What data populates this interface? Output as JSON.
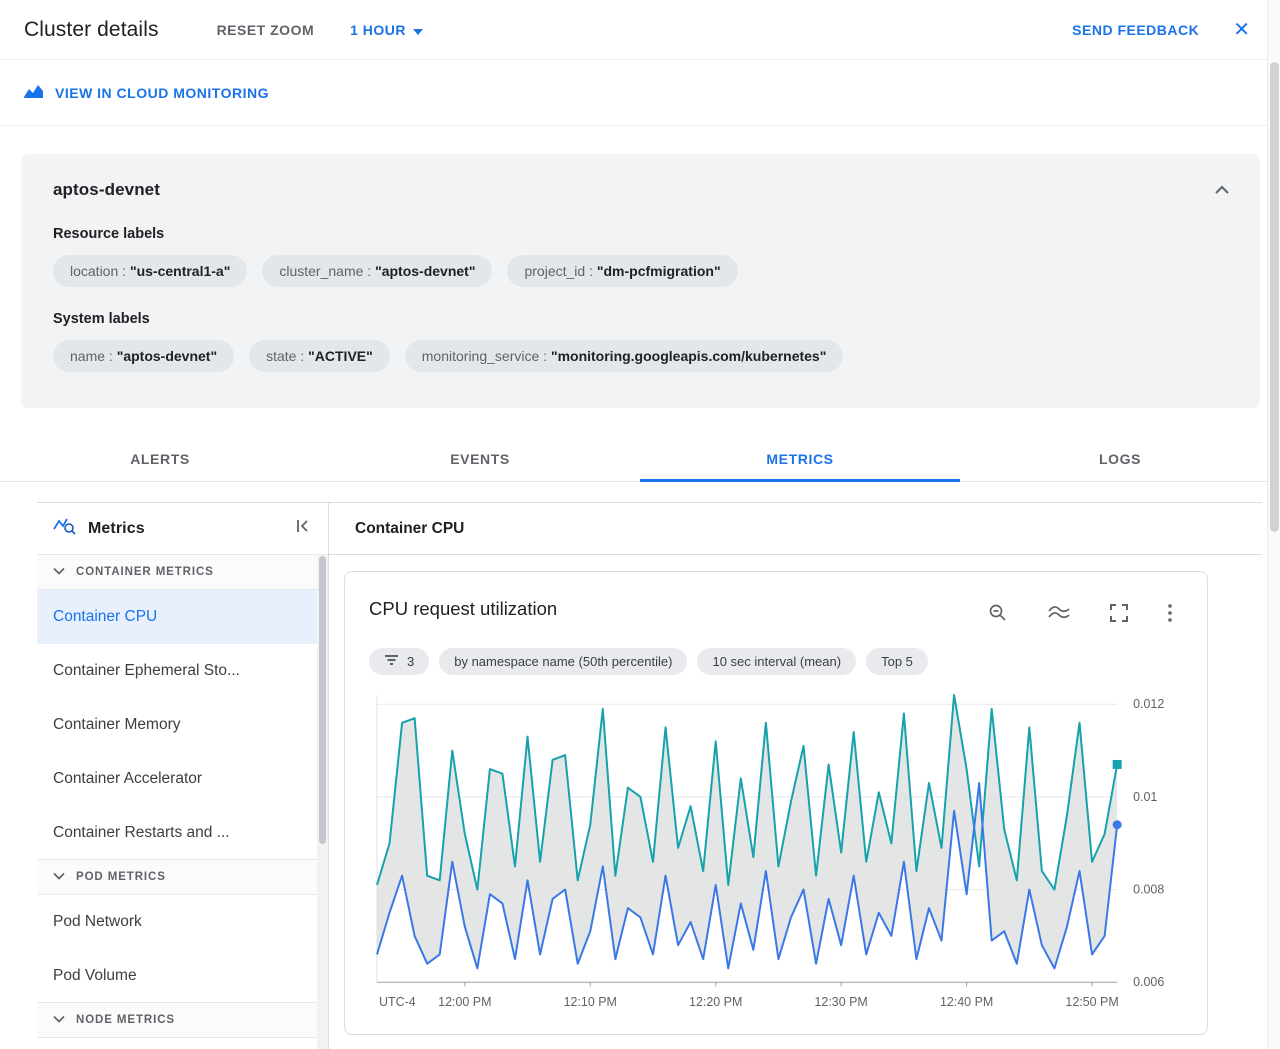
{
  "header": {
    "title": "Cluster details",
    "reset_zoom_label": "RESET ZOOM",
    "time_range_label": "1 HOUR",
    "send_feedback_label": "SEND FEEDBACK"
  },
  "icons": {
    "close_glyph": "✕"
  },
  "theme": {
    "accent_blue": "#1a73e8",
    "selected_item_bg": "#e8f0fe",
    "card_bg": "#f1f3f4"
  },
  "monitoring_bar": {
    "link_label": "VIEW IN CLOUD MONITORING"
  },
  "cluster": {
    "name": "aptos-devnet",
    "label_separator": " : ",
    "resource_labels_title": "Resource labels",
    "resource_labels": [
      {
        "key": "location",
        "value": "\"us-central1-a\""
      },
      {
        "key": "cluster_name",
        "value": "\"aptos-devnet\""
      },
      {
        "key": "project_id",
        "value": "\"dm-pcfmigration\""
      }
    ],
    "system_labels_title": "System labels",
    "system_labels": [
      {
        "key": "name",
        "value": "\"aptos-devnet\""
      },
      {
        "key": "state",
        "value": "\"ACTIVE\""
      },
      {
        "key": "monitoring_service",
        "value": "\"monitoring.googleapis.com/kubernetes\""
      }
    ]
  },
  "tabs": [
    {
      "label": "ALERTS",
      "active": false
    },
    {
      "label": "EVENTS",
      "active": false
    },
    {
      "label": "METRICS",
      "active": true
    },
    {
      "label": "LOGS",
      "active": false
    }
  ],
  "sidebar": {
    "title": "Metrics",
    "selected_item": "Container CPU",
    "sections": [
      {
        "label": "CONTAINER METRICS",
        "items": [
          "Container CPU",
          "Container Ephemeral Sto...",
          "Container Memory",
          "Container Accelerator",
          "Container Restarts and ..."
        ]
      },
      {
        "label": "POD METRICS",
        "items": [
          "Pod Network",
          "Pod Volume"
        ]
      },
      {
        "label": "NODE METRICS",
        "items": []
      }
    ]
  },
  "main": {
    "title": "Container CPU"
  },
  "chart": {
    "title": "CPU request utilization",
    "filters": {
      "count": "3",
      "breakdown": "by namespace name (50th percentile)",
      "interval": "10 sec interval (mean)",
      "top": "Top 5"
    }
  },
  "chart_data": {
    "type": "line",
    "title": "CPU request utilization",
    "x_corner_label": "UTC-4",
    "x_ticks": [
      {
        "min": 7,
        "label": "12:00 PM"
      },
      {
        "min": 17,
        "label": "12:10 PM"
      },
      {
        "min": 27,
        "label": "12:20 PM"
      },
      {
        "min": 37,
        "label": "12:30 PM"
      },
      {
        "min": 47,
        "label": "12:40 PM"
      },
      {
        "min": 57,
        "label": "12:50 PM"
      }
    ],
    "y_ticks": [
      {
        "value": 0.012,
        "label": "0.012"
      },
      {
        "value": 0.01,
        "label": "0.01"
      },
      {
        "value": 0.008,
        "label": "0.008"
      },
      {
        "value": 0.006,
        "label": "0.006"
      }
    ],
    "y_gridlines": [
      0.008,
      0.01,
      0.012
    ],
    "ylim": [
      0.006,
      0.0122
    ],
    "grid": true,
    "legend": "none",
    "band_color": "#dddedf",
    "series": [
      {
        "name": "teal-series",
        "color": "#16a2ac",
        "marker": "square",
        "values": [
          0.0081,
          0.009,
          0.0116,
          0.0117,
          0.0083,
          0.0082,
          0.011,
          0.0092,
          0.008,
          0.0106,
          0.0105,
          0.0085,
          0.0113,
          0.0086,
          0.0108,
          0.0109,
          0.0082,
          0.0094,
          0.0119,
          0.0083,
          0.0102,
          0.01,
          0.0086,
          0.0115,
          0.0089,
          0.0098,
          0.0084,
          0.0112,
          0.0081,
          0.0104,
          0.0087,
          0.0116,
          0.0085,
          0.0099,
          0.0111,
          0.0083,
          0.0107,
          0.0088,
          0.0114,
          0.0086,
          0.0101,
          0.009,
          0.0118,
          0.0084,
          0.0103,
          0.0089,
          0.0122,
          0.0106,
          0.0085,
          0.0119,
          0.0093,
          0.0082,
          0.0115,
          0.0084,
          0.008,
          0.0096,
          0.0116,
          0.0086,
          0.0092,
          0.0107
        ]
      },
      {
        "name": "blue-series",
        "color": "#3b78e7",
        "marker": "circle",
        "values": [
          0.0066,
          0.0075,
          0.0083,
          0.007,
          0.0064,
          0.0066,
          0.0086,
          0.0072,
          0.0063,
          0.0079,
          0.0077,
          0.0065,
          0.0082,
          0.0066,
          0.0078,
          0.008,
          0.0064,
          0.0071,
          0.0085,
          0.0065,
          0.0076,
          0.0074,
          0.0066,
          0.0083,
          0.0068,
          0.0073,
          0.0065,
          0.0081,
          0.0063,
          0.0077,
          0.0067,
          0.0084,
          0.0065,
          0.0074,
          0.008,
          0.0064,
          0.0078,
          0.0068,
          0.0083,
          0.0066,
          0.0075,
          0.007,
          0.0086,
          0.0065,
          0.0076,
          0.0069,
          0.0097,
          0.0079,
          0.0103,
          0.0069,
          0.0071,
          0.0064,
          0.008,
          0.0068,
          0.0063,
          0.0072,
          0.0084,
          0.0066,
          0.007,
          0.0094
        ]
      }
    ]
  }
}
